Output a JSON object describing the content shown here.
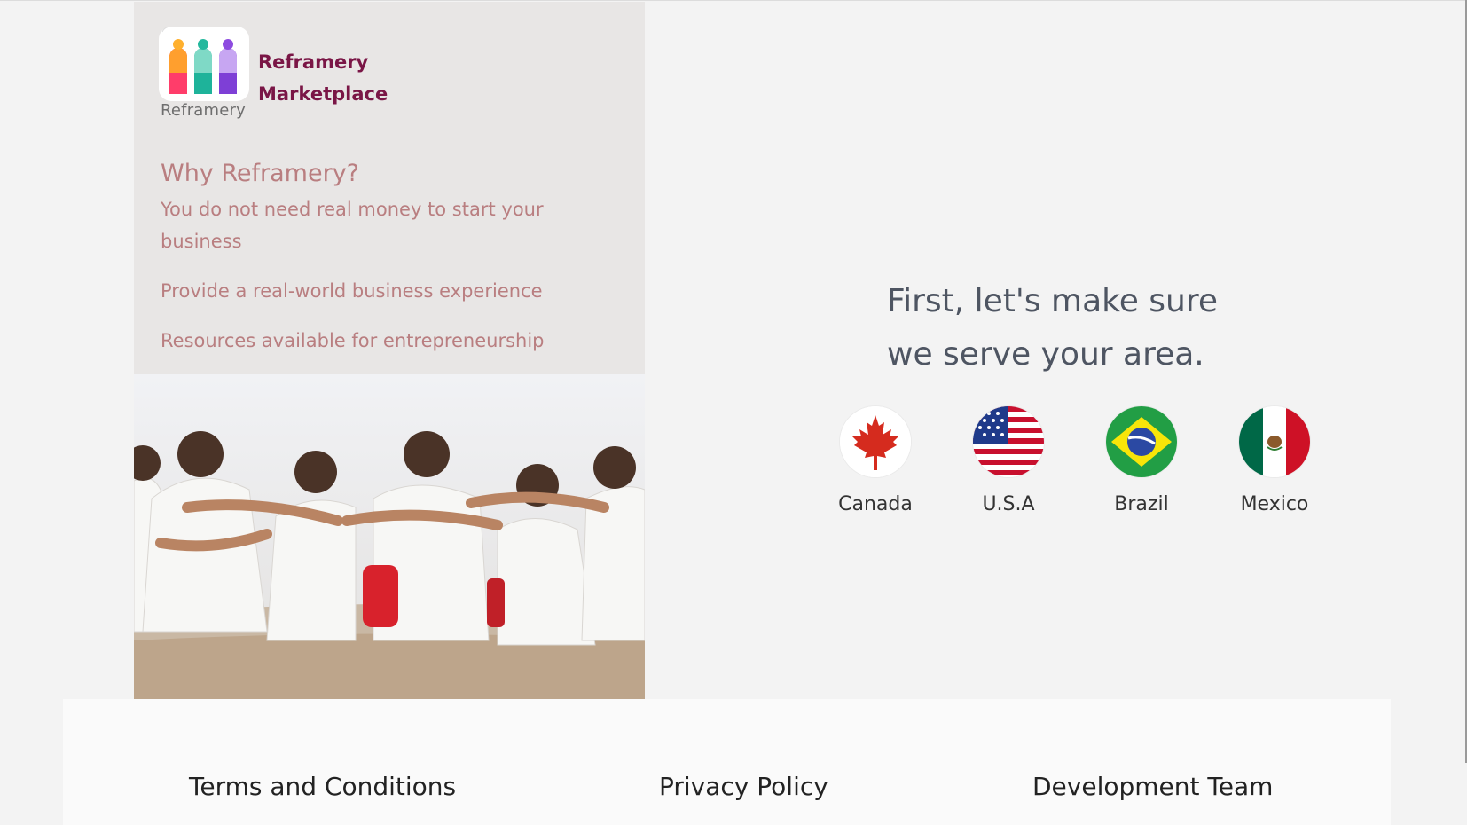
{
  "brand": {
    "name_line1": "Reframery",
    "name_line2": "Marketplace",
    "logo_word": "Reframery"
  },
  "why": {
    "heading": "Why Reframery?",
    "points": [
      "You do not need real money to start your business",
      "Provide a real-world business experience",
      "Resources available for entrepreneurship"
    ]
  },
  "main": {
    "headline_line1": "First, let's make sure",
    "headline_line2": "we serve your area."
  },
  "countries": [
    {
      "label": "Canada",
      "icon": "canada-flag-icon"
    },
    {
      "label": "U.S.A",
      "icon": "usa-flag-icon"
    },
    {
      "label": "Brazil",
      "icon": "brazil-flag-icon"
    },
    {
      "label": "Mexico",
      "icon": "mexico-flag-icon"
    }
  ],
  "footer": {
    "terms": "Terms and Conditions",
    "privacy": "Privacy Policy",
    "team": "Development Team"
  },
  "colors": {
    "brand": "#7a1646",
    "why_text": "#b97e80",
    "headline": "#4e5562"
  }
}
